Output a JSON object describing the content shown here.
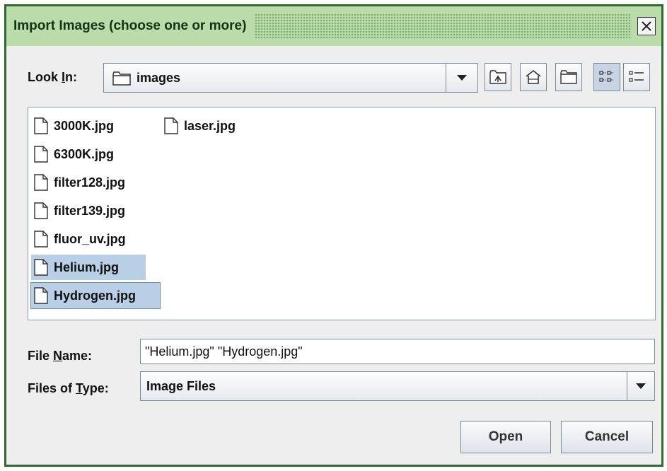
{
  "dialog": {
    "title": "Import Images (choose one or more)"
  },
  "look_in": {
    "label_pre": "Look ",
    "label_mnemonic": "I",
    "label_post": "n:",
    "value": "images"
  },
  "toolbar": {
    "icons": [
      "up-one-level-icon",
      "home-icon",
      "new-folder-icon",
      "list-view-icon",
      "details-view-icon"
    ]
  },
  "files": [
    {
      "name": "3000K.jpg",
      "selected": false
    },
    {
      "name": "6300K.jpg",
      "selected": false
    },
    {
      "name": "filter128.jpg",
      "selected": false
    },
    {
      "name": "filter139.jpg",
      "selected": false
    },
    {
      "name": "fluor_uv.jpg",
      "selected": false
    },
    {
      "name": "Helium.jpg",
      "selected": true
    },
    {
      "name": "Hydrogen.jpg",
      "selected": true
    },
    {
      "name": "laser.jpg",
      "selected": false
    }
  ],
  "file_name": {
    "label_pre": "File ",
    "label_mnemonic": "N",
    "label_post": "ame:",
    "value": "\"Helium.jpg\" \"Hydrogen.jpg\""
  },
  "file_type": {
    "label_pre": "Files of ",
    "label_mnemonic": "T",
    "label_post": "ype:",
    "value": "Image Files"
  },
  "buttons": {
    "open": "Open",
    "cancel": "Cancel"
  },
  "colors": {
    "title_bg": "#b9dcaa",
    "border": "#2e6b2e",
    "selection": "#b8cfe5"
  }
}
